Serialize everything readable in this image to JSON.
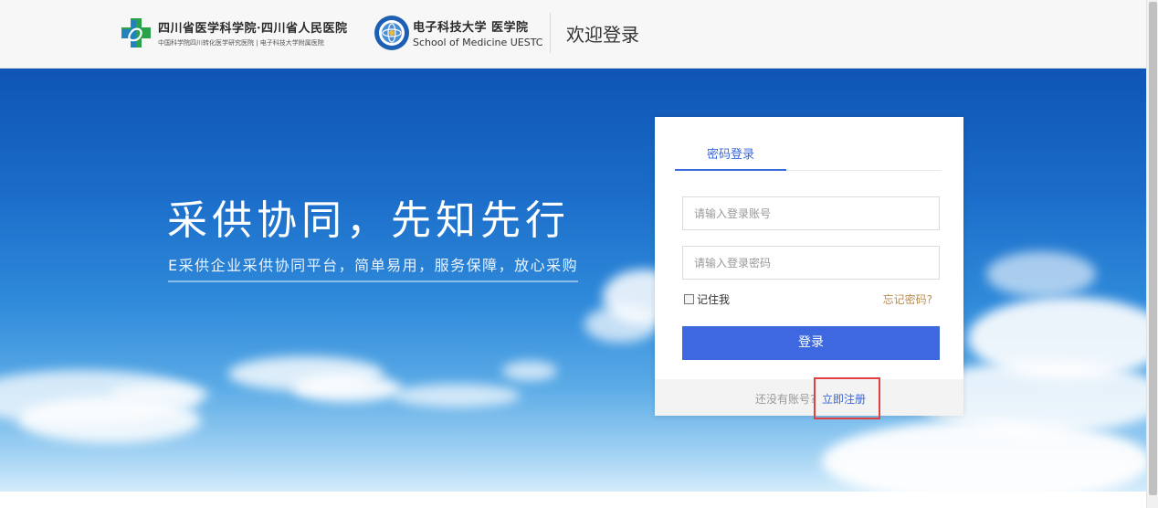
{
  "header": {
    "institution1": {
      "name": "四川省医学科学院·四川省人民医院",
      "subtitle": "中国科学院四川转化医学研究医院 | 电子科技大学附属医院"
    },
    "institution2": {
      "name": "电子科技大学 医学院",
      "subtitle": "School of Medicine UESTC"
    },
    "page_title": "欢迎登录"
  },
  "banner": {
    "slogan": "采供协同，先知先行",
    "subtitle": "E采供企业采供协同平台，简单易用，服务保障，放心采购"
  },
  "login": {
    "tab_label": "密码登录",
    "username_placeholder": "请输入登录账号",
    "password_placeholder": "请输入登录密码",
    "remember_label": "记住我",
    "forgot_label": "忘记密码?",
    "submit_label": "登录",
    "no_account_text": "还没有账号?",
    "register_label": "立即注册"
  },
  "colors": {
    "primary": "#3d68e0",
    "forgot": "#b78c54",
    "highlight": "#e04040",
    "banner_top": "#0f55b5"
  },
  "icons": {
    "logo1": "hospital-cross-logo-icon",
    "logo2": "uestc-seal-logo-icon"
  }
}
